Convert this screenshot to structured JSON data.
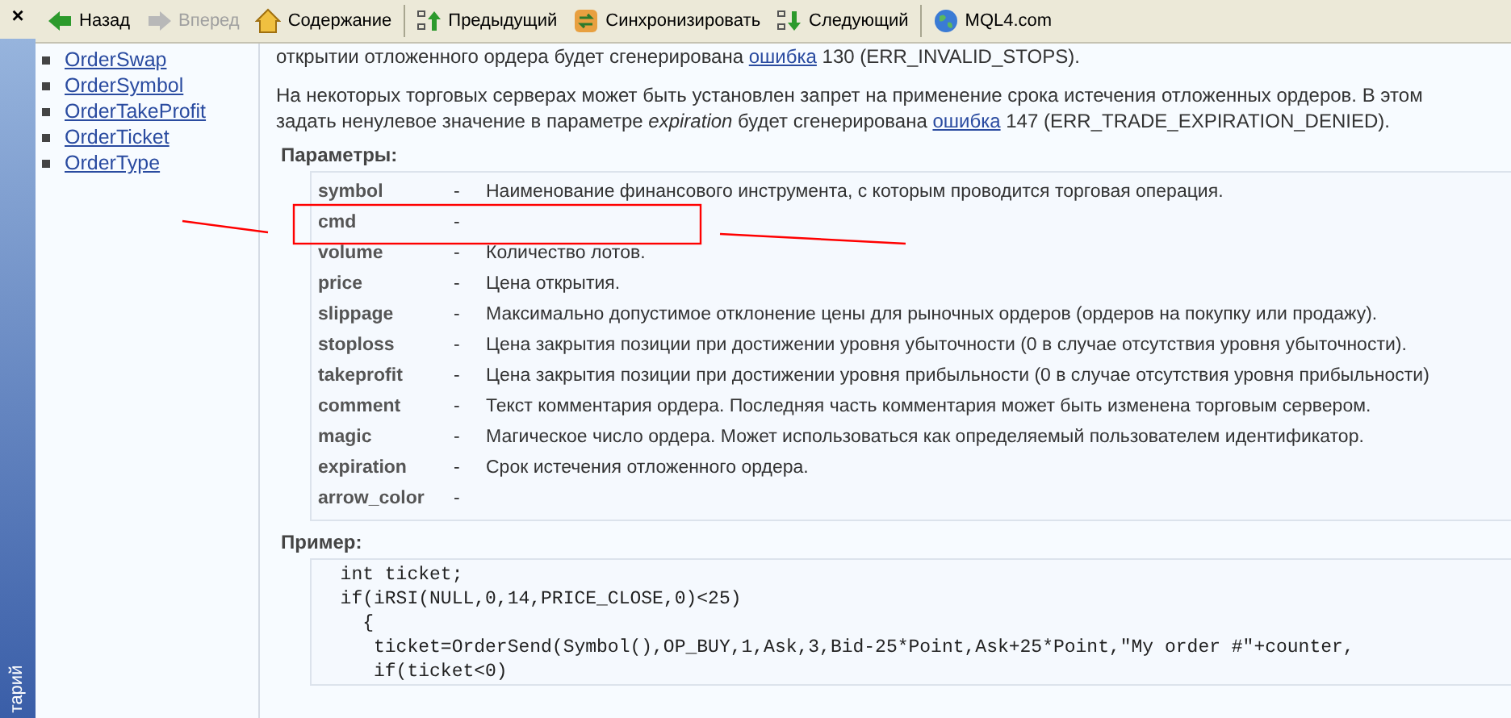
{
  "side_strip": {
    "close": "×",
    "caption": "тарий"
  },
  "toolbar": [
    {
      "label": "Назад",
      "disabled": false
    },
    {
      "label": "Вперед",
      "disabled": true
    },
    {
      "label": "Содержание",
      "disabled": false
    },
    {
      "label": "Предыдущий",
      "disabled": false
    },
    {
      "label": "Синхронизировать",
      "disabled": false
    },
    {
      "label": "Следующий",
      "disabled": false
    },
    {
      "label": "MQL4.com",
      "disabled": false
    }
  ],
  "sidebar": {
    "items": [
      "OrderSwap",
      "OrderSymbol",
      "OrderTakeProfit",
      "OrderTicket",
      "OrderType"
    ]
  },
  "content": {
    "top_line": {
      "before": "открытии отложенного ордера будет сгенерирована ",
      "link": "ошибка",
      "after": " 130 (ERR_INVALID_STOPS)."
    },
    "paragraph": {
      "line1": "На некоторых торговых серверах может быть установлен запрет на применение срока истечения отложенных ордеров. В этом",
      "before": "задать ненулевое значение в параметре *expiration* будет сгенерирована ",
      "link": "ошибка",
      "after": " 147 (ERR_TRADE_EXPIRATION_DENIED)."
    },
    "params_title": "Параметры:",
    "params": [
      {
        "name": "symbol",
        "dash": "-",
        "desc": "Наименование финансового инструмента, с которым проводится торговая операция."
      },
      {
        "name": "cmd",
        "dash": "-"
      },
      {
        "name": "volume",
        "dash": "-",
        "desc": "Количество лотов."
      },
      {
        "name": "price",
        "dash": "-",
        "desc": "Цена открытия."
      },
      {
        "name": "slippage",
        "dash": "-",
        "desc": "Максимально допустимое отклонение цены для рыночных ордеров (ордеров на покупку или продажу)."
      },
      {
        "name": "stoploss",
        "dash": "-",
        "desc": "Цена закрытия позиции при достижении уровня убыточности (0 в случае отсутствия уровня убыточности)."
      },
      {
        "name": "takeprofit",
        "dash": "-",
        "desc": "Цена закрытия позиции при достижении уровня прибыльности (0 в случае отсутствия уровня прибыльности)"
      },
      {
        "name": "comment",
        "dash": "-",
        "desc": "Текст комментария ордера. Последняя часть комментария может быть изменена торговым сервером."
      },
      {
        "name": "magic",
        "dash": "-",
        "desc": "Магическое число ордера. Может использоваться как определяемый пользователем идентификатор."
      },
      {
        "name": "expiration",
        "dash": "-",
        "desc": "Срок истечения отложенного ордера."
      },
      {
        "name": "arrow_color",
        "dash": "-"
      }
    ],
    "example_title": "Пример:",
    "code": [
      "  int ticket;",
      "  if(iRSI(NULL,0,14,PRICE_CLOSE,0)<25)",
      "    {",
      "     ticket=OrderSend(Symbol(),OP_BUY,1,Ask,3,Bid-25*Point,Ask+25*Point,\"My order #\"+counter,",
      "     if(ticket<0)"
    ]
  }
}
